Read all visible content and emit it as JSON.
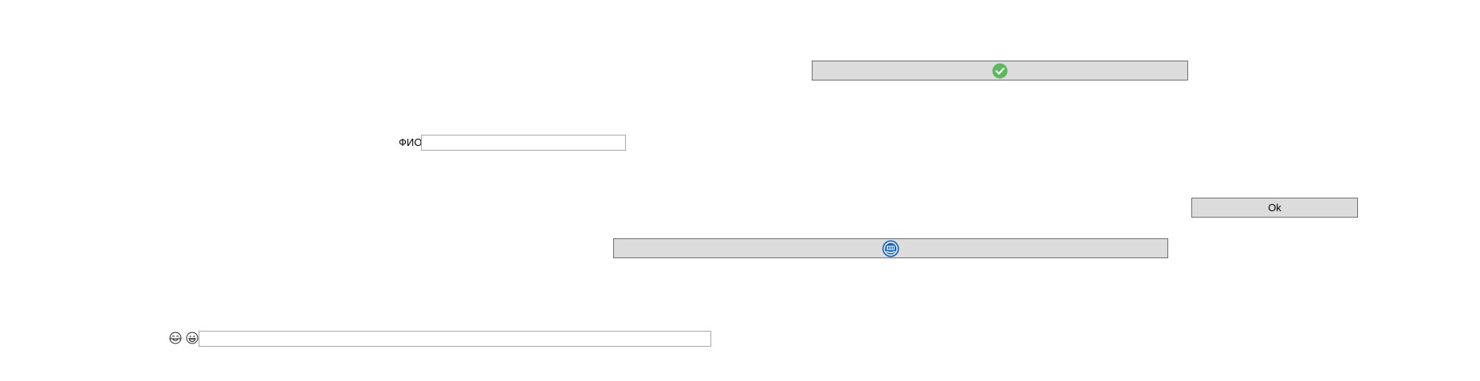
{
  "top_button": {
    "icon": "green-checkmark-icon",
    "icon_color": "#5cb85c"
  },
  "name_form": {
    "label": "ФИО",
    "value": "",
    "placeholder": ""
  },
  "ok_button": {
    "label": "Ok"
  },
  "middle_button": {
    "icon": "blue-badge-icon",
    "icon_color": "#1565c0"
  },
  "emoji_form": {
    "icons": [
      "face-with-tears-of-joy-icon",
      "grinning-face-icon"
    ],
    "value": "",
    "placeholder": ""
  },
  "colors": {
    "button_bg": "#dcdcdc",
    "button_border": "#707070",
    "field_border": "#a9a9a9"
  }
}
